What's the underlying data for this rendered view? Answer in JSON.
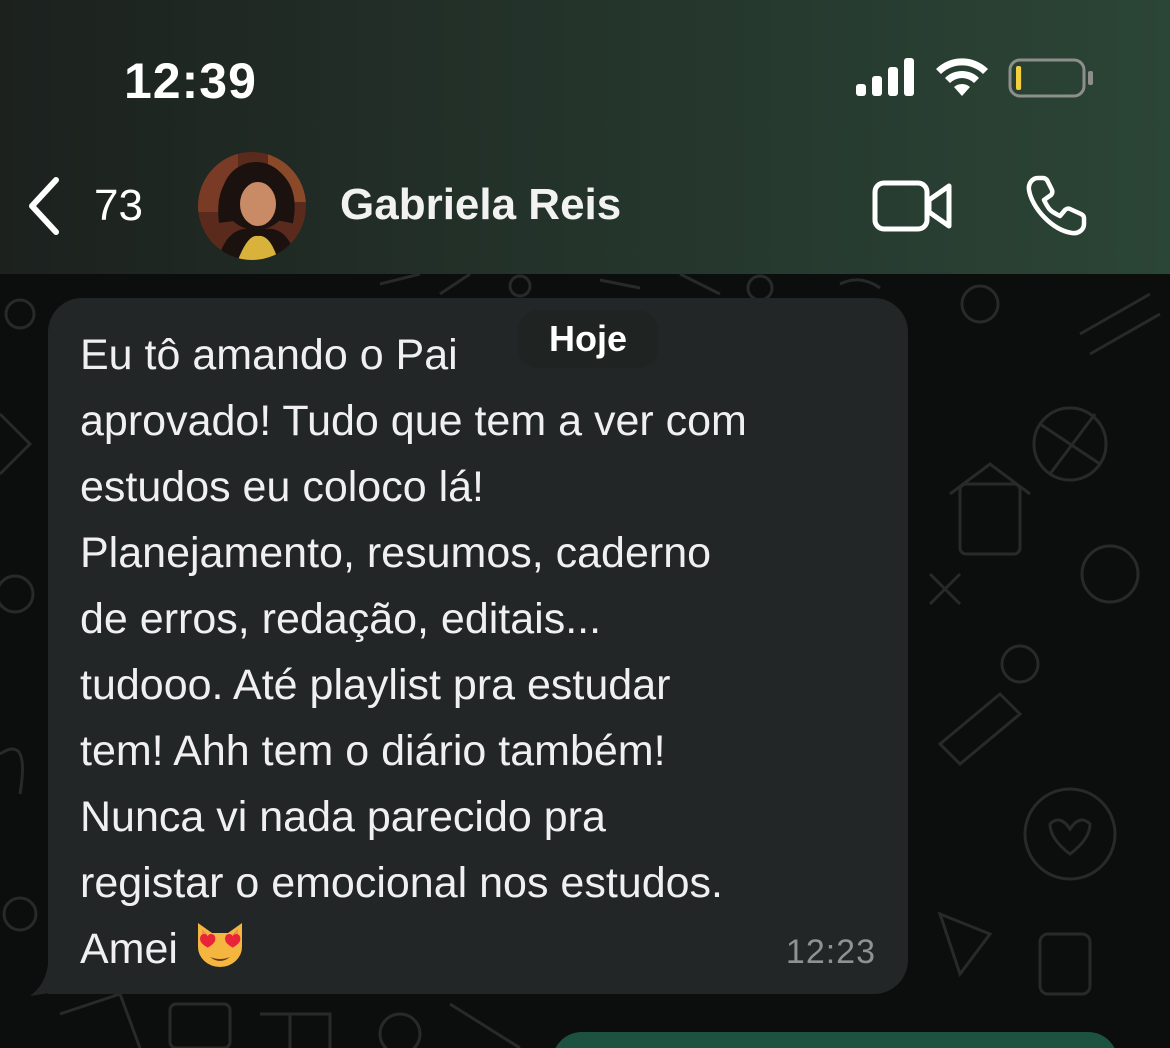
{
  "status_bar": {
    "time": "12:39",
    "signal_icon": "cellular-signal-icon",
    "wifi_icon": "wifi-icon",
    "battery_icon": "battery-low-icon",
    "battery_level": 0.08
  },
  "header": {
    "back_count": "73",
    "contact_name": "Gabriela Reis",
    "video_icon": "video-camera-icon",
    "phone_icon": "phone-icon"
  },
  "chat": {
    "date_label": "Hoje",
    "message": {
      "text": "Eu tô amando o Pai. Hoje aprovado! Tudo que tem a ver com estudos eu coloco lá! Planejamento, resumos, caderno de erros, redação, editais... tudooo. Até playlist pra estudar tem! Ahh tem o diário também! Nunca vi nada parecido pra registar o emocional nos estudos. Amei",
      "lines": [
        "Eu tô amando o Pai",
        "aprovado! Tudo que tem a ver com",
        "estudos eu coloco lá!",
        "Planejamento, resumos, caderno",
        "de erros, redação, editais...",
        "tudooo. Até playlist pra estudar",
        "tem! Ahh tem o diário também!",
        "Nunca vi nada parecido pra",
        "registar o emocional nos estudos.",
        "Amei"
      ],
      "emoji": "heart-eyes-cat-emoji",
      "time": "12:23"
    }
  },
  "colors": {
    "header_gradient_start": "#1c211e",
    "header_gradient_end": "#2b4536",
    "bubble_incoming": "#222626",
    "bubble_outgoing": "#1e5240",
    "chat_background": "#0c0e0d",
    "text_primary": "#f0f0f0",
    "text_secondary": "#8d9390"
  }
}
